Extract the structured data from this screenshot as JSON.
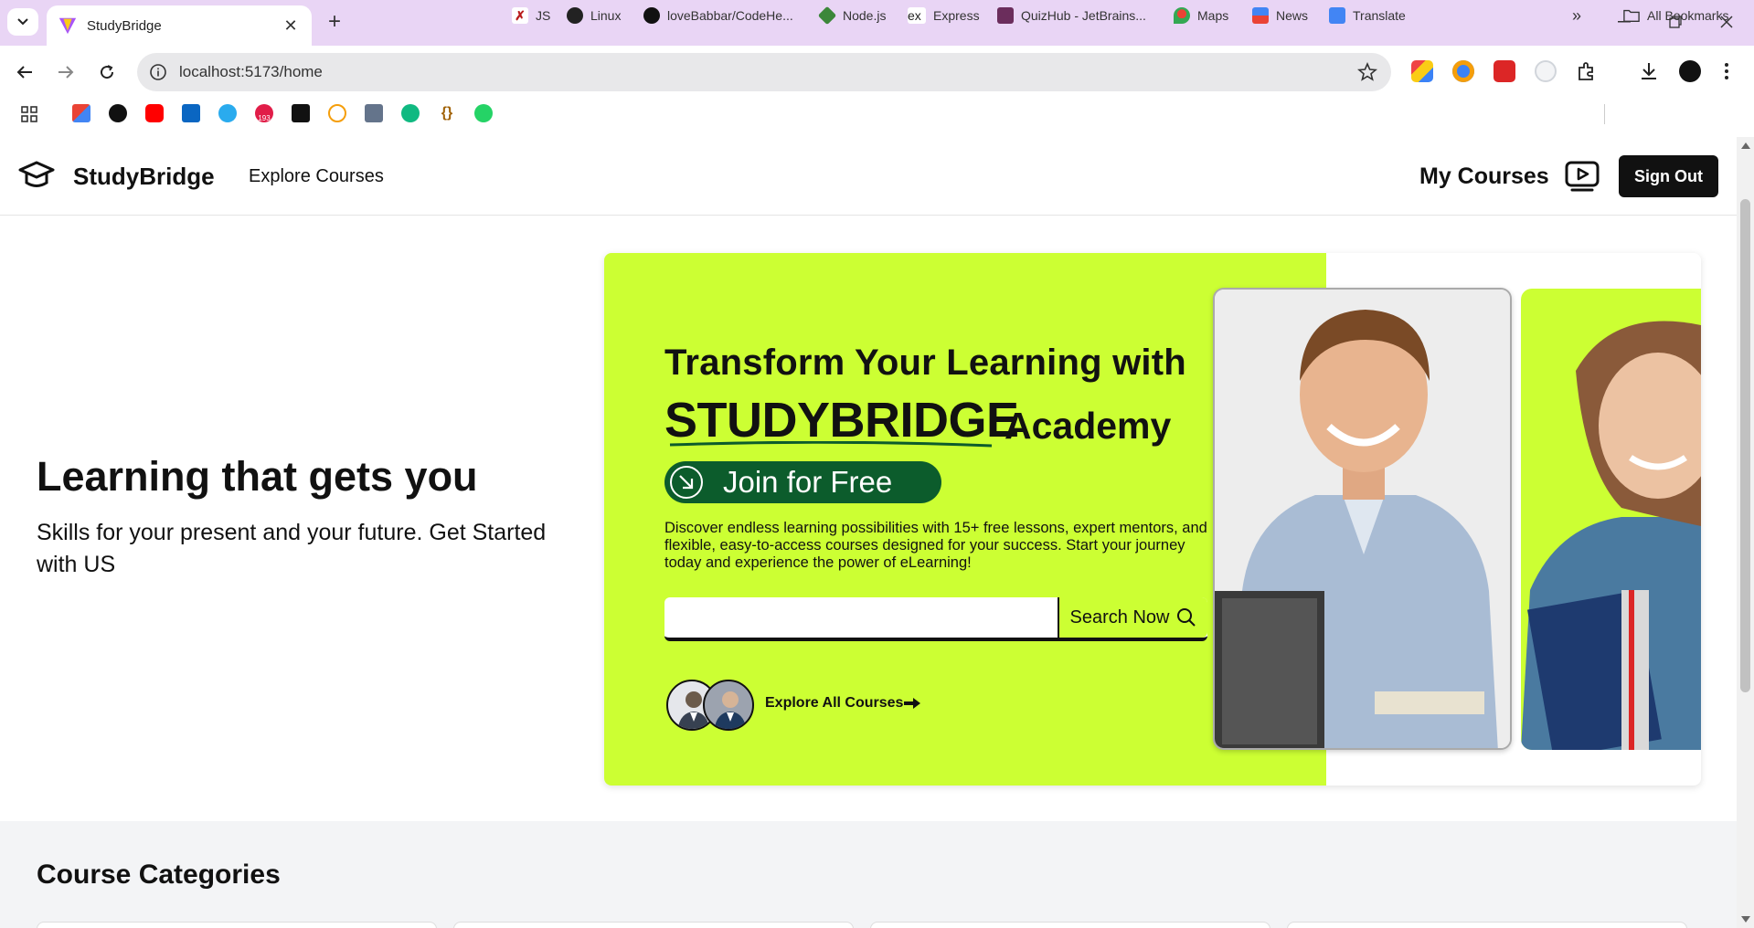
{
  "browser": {
    "tab_title": "StudyBridge",
    "url": "localhost:5173/home",
    "bookmarks": [
      {
        "label": "JS"
      },
      {
        "label": "Linux"
      },
      {
        "label": "loveBabbar/CodeHe..."
      },
      {
        "label": "Node.js"
      },
      {
        "label": "Express"
      },
      {
        "label": "QuizHub - JetBrains..."
      },
      {
        "label": "Maps"
      },
      {
        "label": "News"
      },
      {
        "label": "Translate"
      }
    ],
    "all_bookmarks": "All Bookmarks",
    "badge_count": "193"
  },
  "site": {
    "brand": "StudyBridge",
    "explore": "Explore Courses",
    "my_courses": "My Courses",
    "sign_out": "Sign Out"
  },
  "hero": {
    "title": "Learning that gets you",
    "subtitle": "Skills for your present and your future. Get Started with US"
  },
  "banner": {
    "line1": "Transform Your Learning with",
    "brand": "STUDYBRIDGE",
    "line2_suffix": "Academy",
    "join": "Join for Free",
    "description": "Discover endless learning possibilities with 15+ free lessons, expert mentors, and flexible, easy-to-access courses designed for your success. Start your journey today and experience the power of eLearning!",
    "search_placeholder": "",
    "search_btn": "Search Now",
    "explore_all": "Explore All Courses"
  },
  "categories": {
    "title": "Course Categories"
  },
  "colors": {
    "lime": "#ccff33",
    "dark_green": "#0c5c2c",
    "tab_bar": "#e9d5f5"
  }
}
